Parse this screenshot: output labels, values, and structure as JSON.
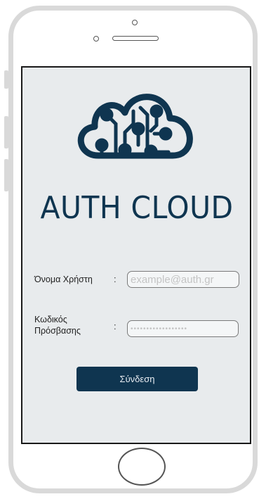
{
  "brand": {
    "title": "AUTH CLOUD",
    "logo_icon": "cloud-circuit-icon"
  },
  "login_form": {
    "username_label": "Όνομα Χρήστη",
    "username_colon": ":",
    "username_placeholder": "example@auth.gr",
    "password_label_line1": "Κωδικός",
    "password_label_line2": "Πρόσβασης",
    "password_colon": ":",
    "password_mask": "••••••••••••••••••",
    "submit_label": "Σύνδεση"
  },
  "colors": {
    "brand": "#0f3550",
    "screen_bg": "#e8ebed",
    "device_frame": "#d9d9d9"
  }
}
